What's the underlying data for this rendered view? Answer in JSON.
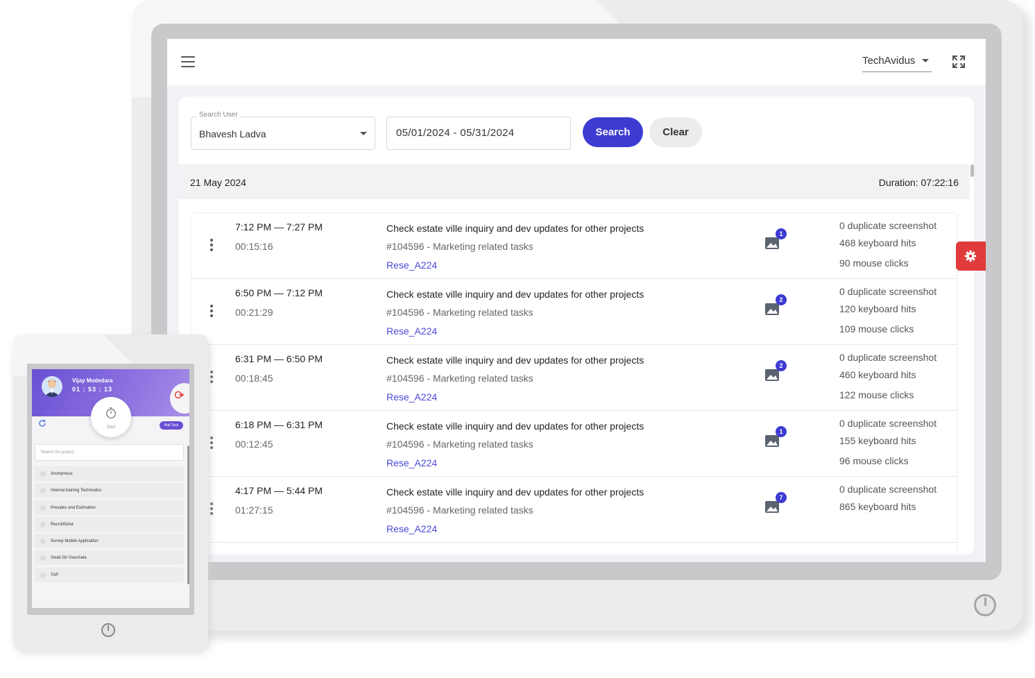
{
  "header": {
    "org_name": "TechAvidus"
  },
  "filters": {
    "user_label": "Search User",
    "user_value": "Bhavesh Ladva",
    "date_range": "05/01/2024 - 05/31/2024",
    "search_label": "Search",
    "clear_label": "Clear"
  },
  "day": {
    "date": "21 May 2024",
    "duration": "Duration: 07:22:16"
  },
  "entries": [
    {
      "time_range": "7:12 PM — 7:27 PM",
      "duration": "00:15:16",
      "title": "Check estate ville inquiry and dev updates for other projects",
      "task": "#104596 - Marketing related tasks",
      "ref": "Rese_A224",
      "screenshots": "1",
      "duplicate": "0 duplicate screenshot",
      "keyboard": "468 keyboard hits",
      "mouse": "90 mouse clicks"
    },
    {
      "time_range": "6:50 PM — 7:12 PM",
      "duration": "00:21:29",
      "title": "Check estate ville inquiry and dev updates for other projects",
      "task": "#104596 - Marketing related tasks",
      "ref": "Rese_A224",
      "screenshots": "2",
      "duplicate": "0 duplicate screenshot",
      "keyboard": "120 keyboard hits",
      "mouse": "109 mouse clicks"
    },
    {
      "time_range": "6:31 PM — 6:50 PM",
      "duration": "00:18:45",
      "title": "Check estate ville inquiry and dev updates for other projects",
      "task": "#104596 - Marketing related tasks",
      "ref": "Rese_A224",
      "screenshots": "2",
      "duplicate": "0 duplicate screenshot",
      "keyboard": "460 keyboard hits",
      "mouse": "122 mouse clicks"
    },
    {
      "time_range": "6:18 PM — 6:31 PM",
      "duration": "00:12:45",
      "title": "Check estate ville inquiry and dev updates for other projects",
      "task": "#104596 - Marketing related tasks",
      "ref": "Rese_A224",
      "screenshots": "1",
      "duplicate": "0 duplicate screenshot",
      "keyboard": "155 keyboard hits",
      "mouse": "96 mouse clicks"
    },
    {
      "time_range": "4:17 PM — 5:44 PM",
      "duration": "01:27:15",
      "title": "Check estate ville inquiry and dev updates for other projects",
      "task": "#104596 - Marketing related tasks",
      "ref": "Rese_A224",
      "screenshots": "7",
      "duplicate": "0 duplicate screenshot",
      "keyboard": "865 keyboard hits",
      "mouse": ""
    }
  ],
  "icons": {
    "menu": "hamburger-menu-icon",
    "fullscreen": "fullscreen-expand-icon",
    "kebab": "vertical-dots-icon",
    "screenshot": "image-icon",
    "settings": "gear-icon",
    "refresh": "refresh-icon",
    "timer": "stopwatch-icon",
    "logout": "logout-icon"
  },
  "colors": {
    "primary": "#3d3bd1",
    "settings_fab": "#e03a3a",
    "tablet_header": "#7b5fdc"
  },
  "tablet": {
    "user_name": "Vijay Modedara",
    "timer": "01 : 53 : 13",
    "start_label": "Start",
    "add_task_label": "Add Task",
    "search_placeholder": "Search for project",
    "projects": [
      "Anonymous",
      "Internal training TechAvidus",
      "Presales and Estimation",
      "RecruitSolut",
      "Survey Mobile Application",
      "Swati Gir Gaushala",
      "TAP"
    ]
  }
}
